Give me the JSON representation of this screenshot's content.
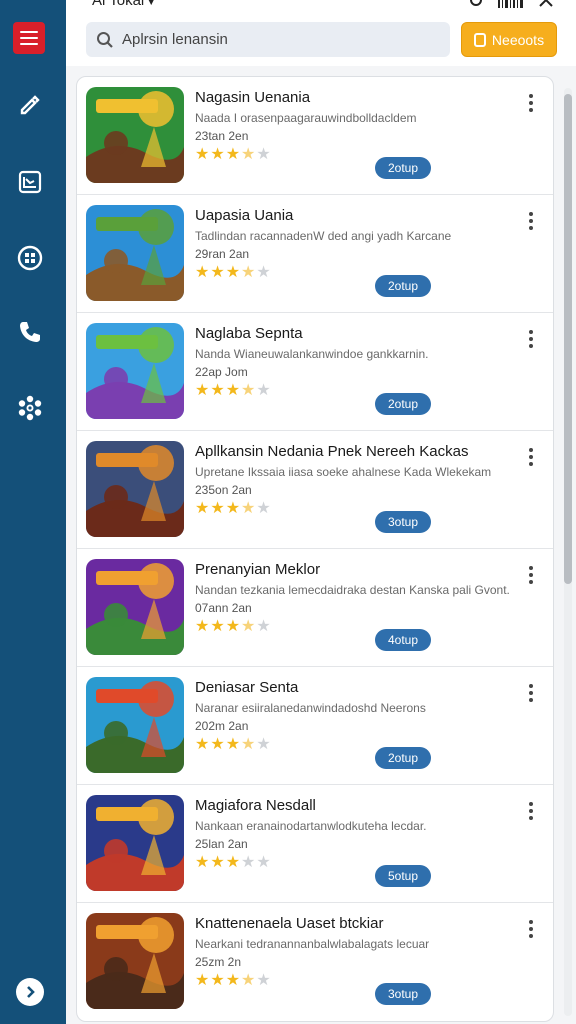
{
  "header": {
    "title": "Al Tokal",
    "search_placeholder": "Aplrsin lenansin",
    "action_label": "Neeoots"
  },
  "rail": {
    "items": [
      "menu-icon",
      "edit-icon",
      "chart-icon",
      "grid-icon",
      "phone-icon",
      "settings-icon"
    ],
    "next_icon": "chevron-right-icon",
    "accent": "#d91f2a",
    "background": "#145079"
  },
  "apps": [
    {
      "title": "Nagasin Uenania",
      "desc": "Naada I orasenpaagarauwindbolldacldem",
      "meta": "23tan 2en",
      "rating": 3.5,
      "button": "2otup",
      "colors": [
        "#2f8f3a",
        "#f0c030",
        "#6b3b1f"
      ]
    },
    {
      "title": "Uapasia Uania",
      "desc": "Tadlindan racannadenW ded angi yadh Karcane",
      "meta": "29ran 2an",
      "rating": 3.5,
      "button": "2otup",
      "colors": [
        "#2c8fd6",
        "#5aa03a",
        "#8a5a2a"
      ]
    },
    {
      "title": "Naglaba Sepnta",
      "desc": "Nanda Wianeuwalankanwindoe gankkarnin.",
      "meta": "22ap Jom",
      "rating": 3.5,
      "button": "2otup",
      "colors": [
        "#3aa0e0",
        "#6cc040",
        "#7a3fb0"
      ]
    },
    {
      "title": "Apllkansin Nedania Pnek Nereeh Kackas",
      "desc": "Upretane Ikssaia iiasa soeke ahalnese Kada Wlekekam",
      "meta": "235on 2an",
      "rating": 3.5,
      "button": "3otup",
      "colors": [
        "#3b4e7a",
        "#e08a2a",
        "#6b2a1a"
      ]
    },
    {
      "title": "Prenanyian Meklor",
      "desc": "Nandan tezkania lemecdaidraka destan Kanska pali Gvont.",
      "meta": "07ann 2an",
      "rating": 3.5,
      "button": "4otup",
      "colors": [
        "#6a2aa0",
        "#f0a030",
        "#3a8a3a"
      ]
    },
    {
      "title": "Deniasar Senta",
      "desc": "Naranar esiiralanedanwindadoshd Neerons",
      "meta": "202m 2an",
      "rating": 3.5,
      "button": "2otup",
      "colors": [
        "#2a9ad0",
        "#e04a2a",
        "#3a6a2a"
      ]
    },
    {
      "title": "Magiafora Nesdall",
      "desc": "Nankaan eranainodartanwlodkuteha lecdar.",
      "meta": "25lan 2an",
      "rating": 3.0,
      "button": "5otup",
      "colors": [
        "#2a3a8a",
        "#f0b030",
        "#c03a2a"
      ]
    },
    {
      "title": "Knattenenaela Uaset btckiar",
      "desc": "Nearkani tedranannanbalwlabalagats lecuar",
      "meta": "25zm 2n",
      "rating": 3.5,
      "button": "3otup",
      "colors": [
        "#8a3a1a",
        "#f0a030",
        "#4a2a1a"
      ]
    }
  ],
  "colors": {
    "star": "#f3b81c",
    "button": "#2f6fad",
    "cta": "#f6ae1d"
  }
}
